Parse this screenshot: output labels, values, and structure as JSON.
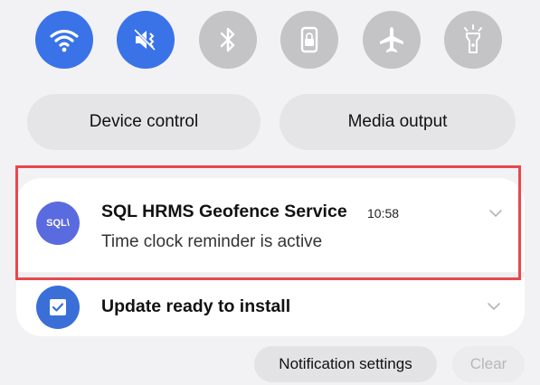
{
  "quick_toggles": [
    {
      "icon": "wifi-icon",
      "state": "on"
    },
    {
      "icon": "mute-icon",
      "state": "on"
    },
    {
      "icon": "bluetooth-icon",
      "state": "off"
    },
    {
      "icon": "lock-icon",
      "state": "off"
    },
    {
      "icon": "airplane-icon",
      "state": "off"
    },
    {
      "icon": "flashlight-icon",
      "state": "off"
    }
  ],
  "buttons": {
    "device_control": "Device control",
    "media_output": "Media output"
  },
  "notifications": [
    {
      "app_icon_text": "SQL\\",
      "title": "SQL HRMS Geofence Service",
      "time": "10:58",
      "body": "Time clock reminder is active"
    },
    {
      "title": "Update ready to install"
    }
  ],
  "footer": {
    "settings_label": "Notification settings",
    "clear_label": "Clear"
  },
  "colors": {
    "toggle_on": "#3a73e8",
    "toggle_off": "#c4c4c6",
    "highlight_border": "#e8474d",
    "app_icon_sql": "#5a6be0"
  }
}
